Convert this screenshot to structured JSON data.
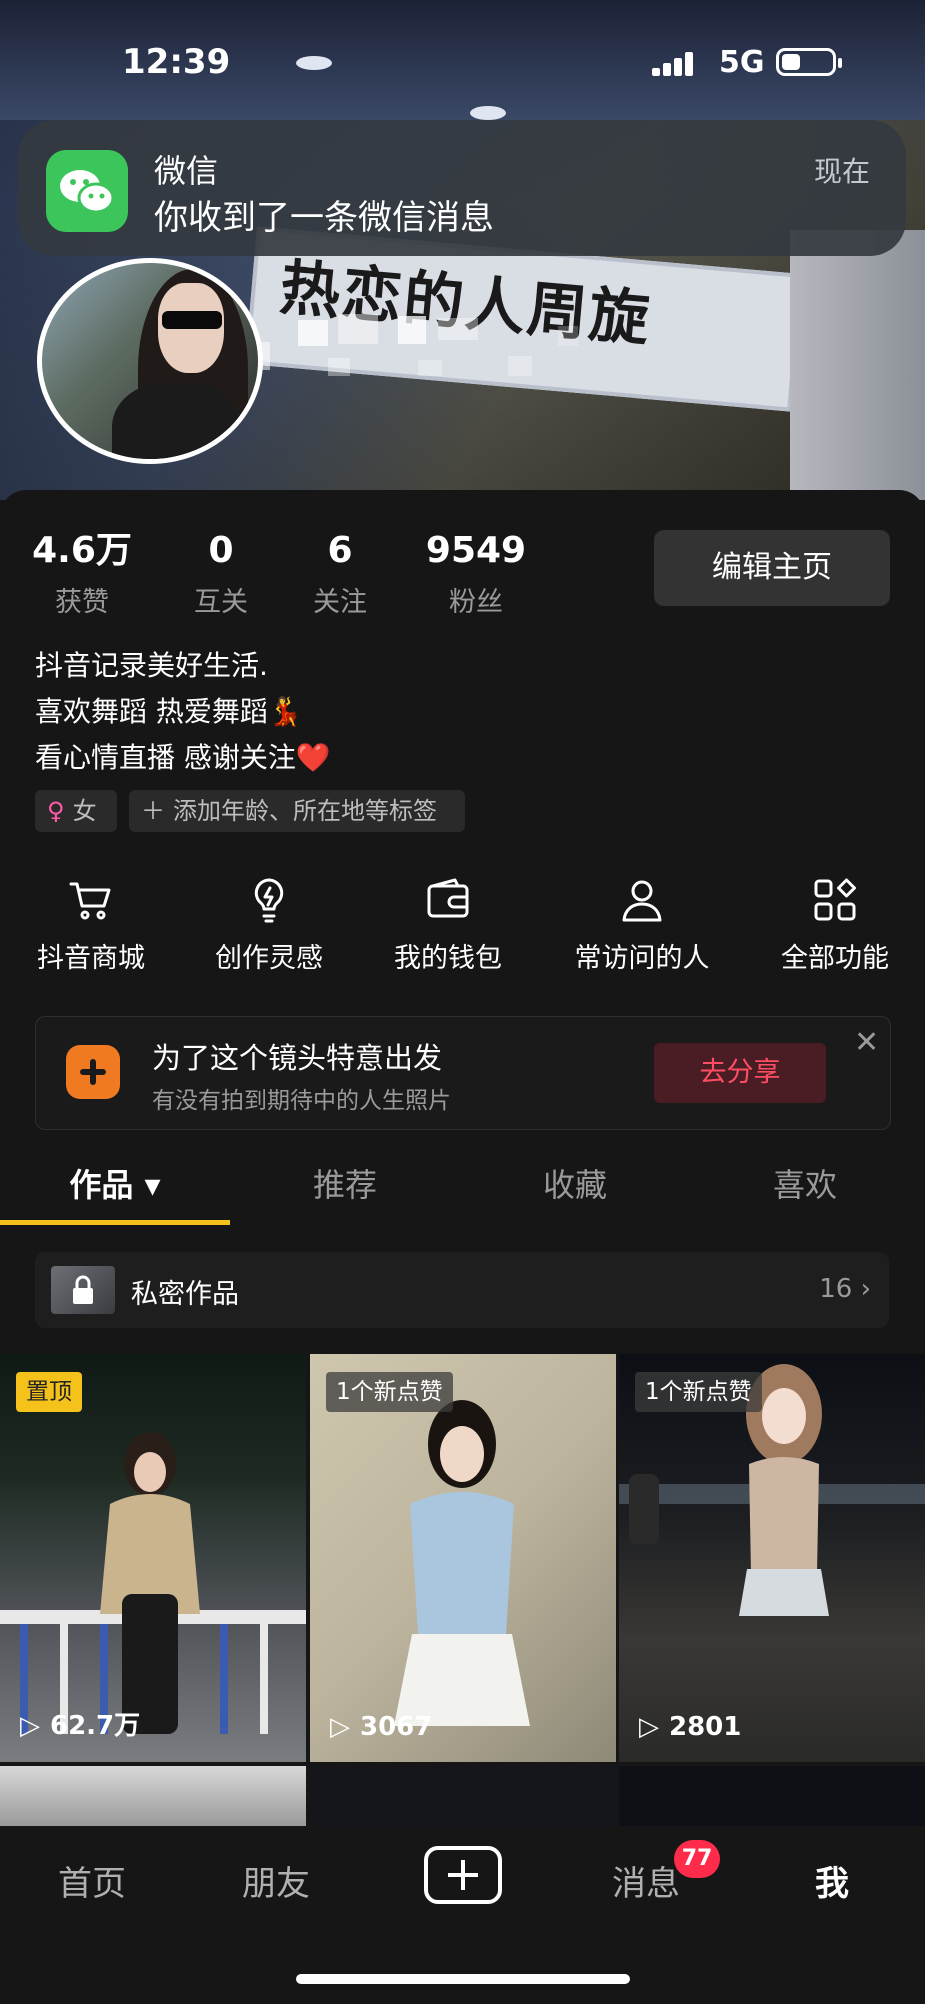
{
  "status_bar": {
    "time": "12:39",
    "network": "5G"
  },
  "notification": {
    "app": "微信",
    "message": "你收到了一条微信消息",
    "time": "现在"
  },
  "header": {
    "banner_text": "热恋的人周旋"
  },
  "stats": [
    {
      "value": "4.6万",
      "label": "获赞"
    },
    {
      "value": "0",
      "label": "互关"
    },
    {
      "value": "6",
      "label": "关注"
    },
    {
      "value": "9549",
      "label": "粉丝"
    }
  ],
  "edit_profile_label": "编辑主页",
  "bio": {
    "line1": "抖音记录美好生活.",
    "line2": "喜欢舞蹈 热爱舞蹈💃",
    "line3": "看心情直播 感谢关注❤️"
  },
  "tags": {
    "gender": "女",
    "add": "添加年龄、所在地等标签"
  },
  "functions": [
    {
      "label": "抖音商城",
      "icon": "cart-icon"
    },
    {
      "label": "创作灵感",
      "icon": "lightbulb-icon"
    },
    {
      "label": "我的钱包",
      "icon": "wallet-icon"
    },
    {
      "label": "常访问的人",
      "icon": "person-icon"
    },
    {
      "label": "全部功能",
      "icon": "grid-icon"
    }
  ],
  "promo": {
    "title": "为了这个镜头特意出发",
    "subtitle": "有没有拍到期待中的人生照片",
    "button": "去分享"
  },
  "tabs": [
    {
      "label": "作品 ▾"
    },
    {
      "label": "推荐"
    },
    {
      "label": "收藏"
    },
    {
      "label": "喜欢"
    }
  ],
  "private_works": {
    "label": "私密作品",
    "count": "16 ›"
  },
  "videos": [
    {
      "badge": "置顶",
      "views": "62.7万"
    },
    {
      "badge": "1个新点赞",
      "views": "3067"
    },
    {
      "badge": "1个新点赞",
      "views": "2801"
    }
  ],
  "bottom_nav": {
    "home": "首页",
    "friends": "朋友",
    "messages": "消息",
    "messages_badge": "77",
    "me": "我"
  },
  "colors": {
    "accent": "#f4c21b",
    "badge_red": "#ff2b4a",
    "share_text": "#ff4d63",
    "wechat_green": "#3bc55a"
  }
}
